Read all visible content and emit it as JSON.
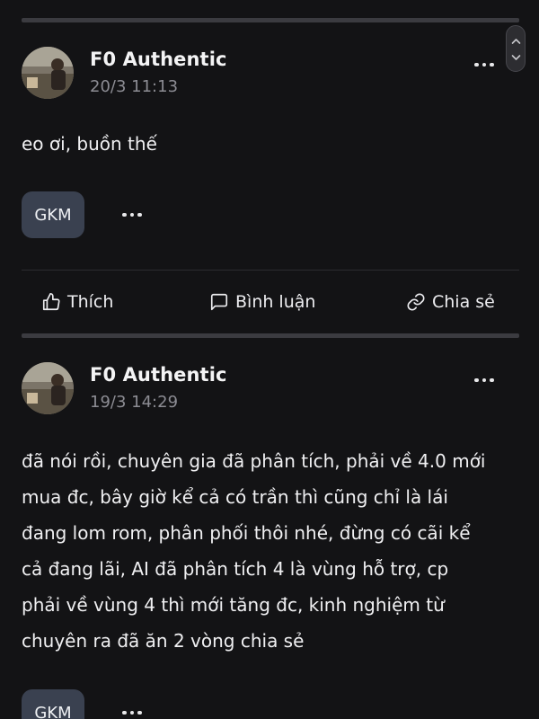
{
  "posts": [
    {
      "author": "F0 Authentic",
      "timestamp": "20/3 11:13",
      "content": "eo ơi, buồn thế",
      "reaction_label": "GKM",
      "actions": {
        "like": "Thích",
        "comment": "Bình luận",
        "share": "Chia sẻ"
      }
    },
    {
      "author": "F0 Authentic",
      "timestamp": "19/3 14:29",
      "content": "đã nói rồi, chuyên gia đã phân tích, phải về 4.0 mới\nmua đc, bây giờ kể cả có trần thì cũng chỉ là lái\nđang lom rom, phân phối thôi nhé, đừng có cãi kể\ncả đang lãi, AI đã phân tích 4 là vùng hỗ trợ, cp\nphải về vùng 4 thì mới tăng đc, kinh nghiệm từ\nchuyên ra đã ăn 2 vòng chia sẻ",
      "reaction_label": "GKM"
    }
  ],
  "icons": {
    "more": "more-horizontal-icon",
    "like": "thumbs-up-icon",
    "comment": "message-square-icon",
    "share": "link-icon",
    "scroll_up": "chevron-up-icon",
    "scroll_down": "chevron-down-icon"
  },
  "colors": {
    "background": "#131315",
    "reaction_chip": "#3a4150",
    "muted_text": "#8c8c93"
  }
}
